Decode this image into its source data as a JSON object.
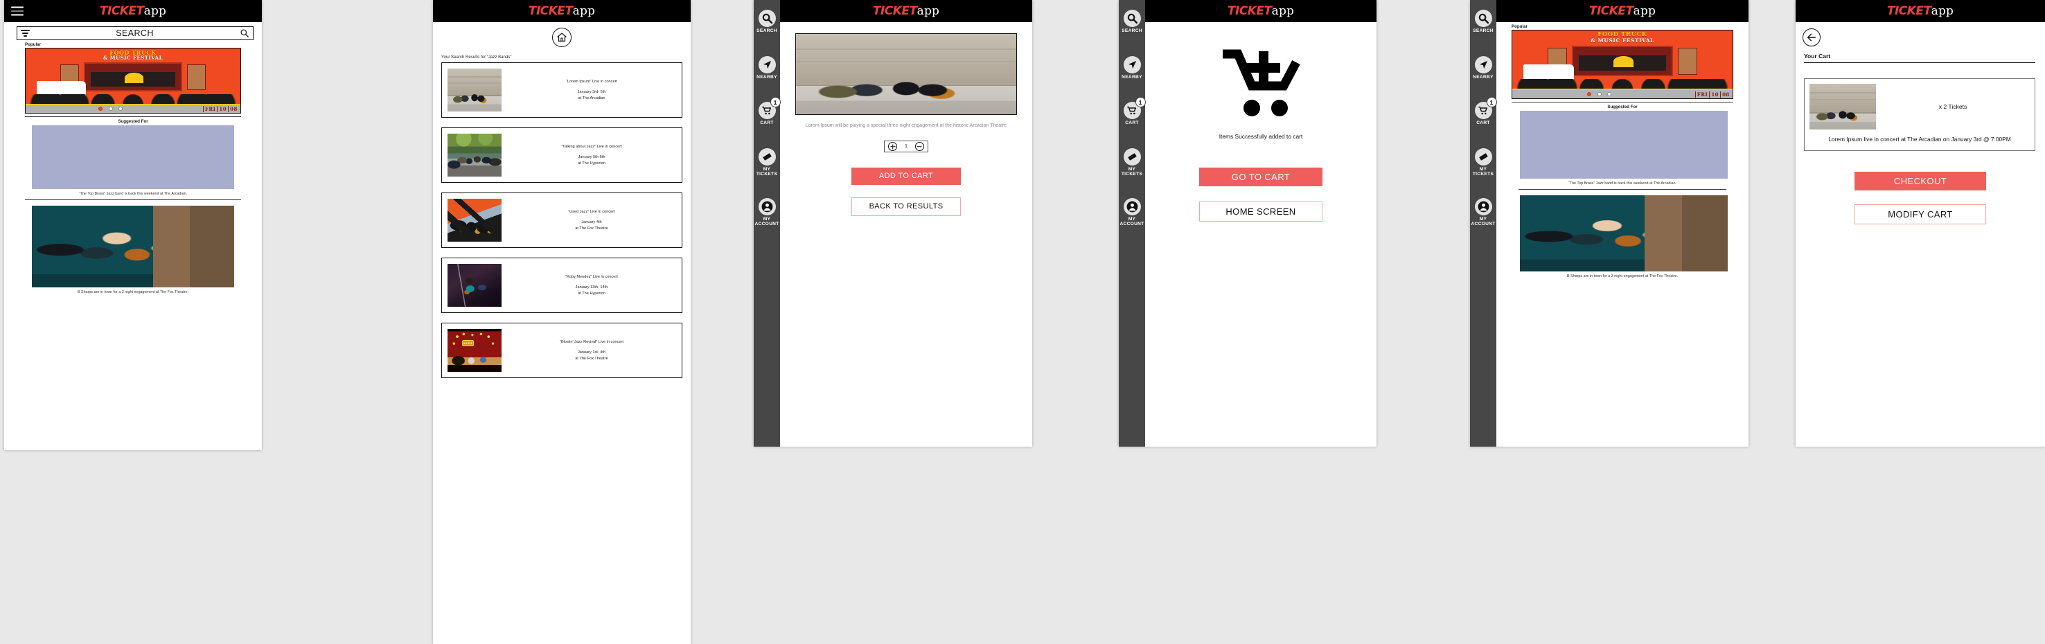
{
  "brand": {
    "part1": "TICKET",
    "part2": "app",
    "accent": "#e8433f"
  },
  "theme": {
    "primary": "#ef5d5d",
    "rail_bg": "#474747",
    "topbar_bg": "#000000"
  },
  "rail": {
    "items": [
      {
        "label": "SEARCH",
        "icon": "search-icon",
        "badge": ""
      },
      {
        "label": "NEARBY",
        "icon": "navigation-arrow-icon",
        "badge": ""
      },
      {
        "label": "CART",
        "icon": "cart-icon",
        "badge": "1"
      },
      {
        "label": "MY\nTICKETS",
        "label_l1": "MY",
        "label_l2": "TICKETS",
        "icon": "ticket-icon",
        "badge": ""
      },
      {
        "label": "MY\nACCOUNT",
        "label_l1": "MY",
        "label_l2": "ACCOUNT",
        "icon": "person-icon",
        "badge": ""
      }
    ]
  },
  "screen1": {
    "menu_icon": "hamburger-icon",
    "search": {
      "placeholder": "SEARCH",
      "value": "SEARCH",
      "filter_icon": "filter-icon",
      "search_icon": "search-icon"
    },
    "popular_label": "Popular",
    "suggested_label": "Suggested For",
    "poster": {
      "title_line1": "FOOD TRUCK",
      "title_line2": "& MUSIC FESTIVAL",
      "date_day": "FRI",
      "date_num": "10",
      "date_month": "08",
      "dots": 3,
      "active_dot": 0
    },
    "cards": [
      {
        "caption": "“The Top Brass” Jazz band is back this weekend at The Arcadian."
      },
      {
        "caption": "B Sharps are in town for a 3 night engagement at The Fox Theatre."
      }
    ]
  },
  "screen2": {
    "home_icon": "home-icon",
    "results_heading": "Your Search Results for “Jazz Bands”",
    "results": [
      {
        "title": "“Lorem Ipsum” Live in concert",
        "date": "January 3rd- 5th",
        "venue": "at The Arcadian"
      },
      {
        "title": "“Talking about Jazz” Live in concert",
        "date": "January 5th-6th",
        "venue": "at The Hyperion"
      },
      {
        "title": "“Used Jazz” Live in concert",
        "date": "January 4th",
        "venue": "at The Fox Theatre"
      },
      {
        "title": "“Koby Mendez” Live in concert",
        "date": "January 13th- 14th",
        "venue": "at The Hyperion"
      },
      {
        "title": "“Blowin’ Jazz Revival” Live in concert",
        "date": "January 1st- 4th",
        "venue": "at The Fox Theatre"
      }
    ]
  },
  "screen3": {
    "description": "Lorem Ipsum will be playing a special three night engagement at the historic Arcadian Theatre",
    "stepper": {
      "increment": "+",
      "quantity": "1",
      "decrement": "−"
    },
    "add_to_cart_label": "ADD TO CART",
    "back_to_results_label": "BACK TO RESULTS"
  },
  "screen4": {
    "hero_icon": "cart-plus-icon",
    "message": "Items Successfully added to cart",
    "go_to_cart_label": "GO TO CART",
    "home_screen_label": "HOME SCREEN"
  },
  "screen5": {
    "popular_label": "Popular",
    "suggested_label": "Suggested For",
    "poster": {
      "title_line1": "FOOD TRUCK",
      "title_line2": "& MUSIC FESTIVAL",
      "date_day": "FRI",
      "date_num": "10",
      "date_month": "08"
    },
    "cards": [
      {
        "caption": "“The Top Brass” Jazz band is back this weekend at The Arcadian."
      },
      {
        "caption": "B Sharps are in town for a 3 night engagement at The Fox Theatre."
      }
    ]
  },
  "screen6": {
    "back_icon": "back-arrow-icon",
    "title": "Your Cart",
    "item": {
      "quantity_label": "x 2 Tickets",
      "caption": "Lorem Ipsum live in concert at The Arcadian on January 3rd @ 7:00PM"
    },
    "checkout_label": "CHECKOUT",
    "modify_cart_label": "MODIFY CART"
  }
}
